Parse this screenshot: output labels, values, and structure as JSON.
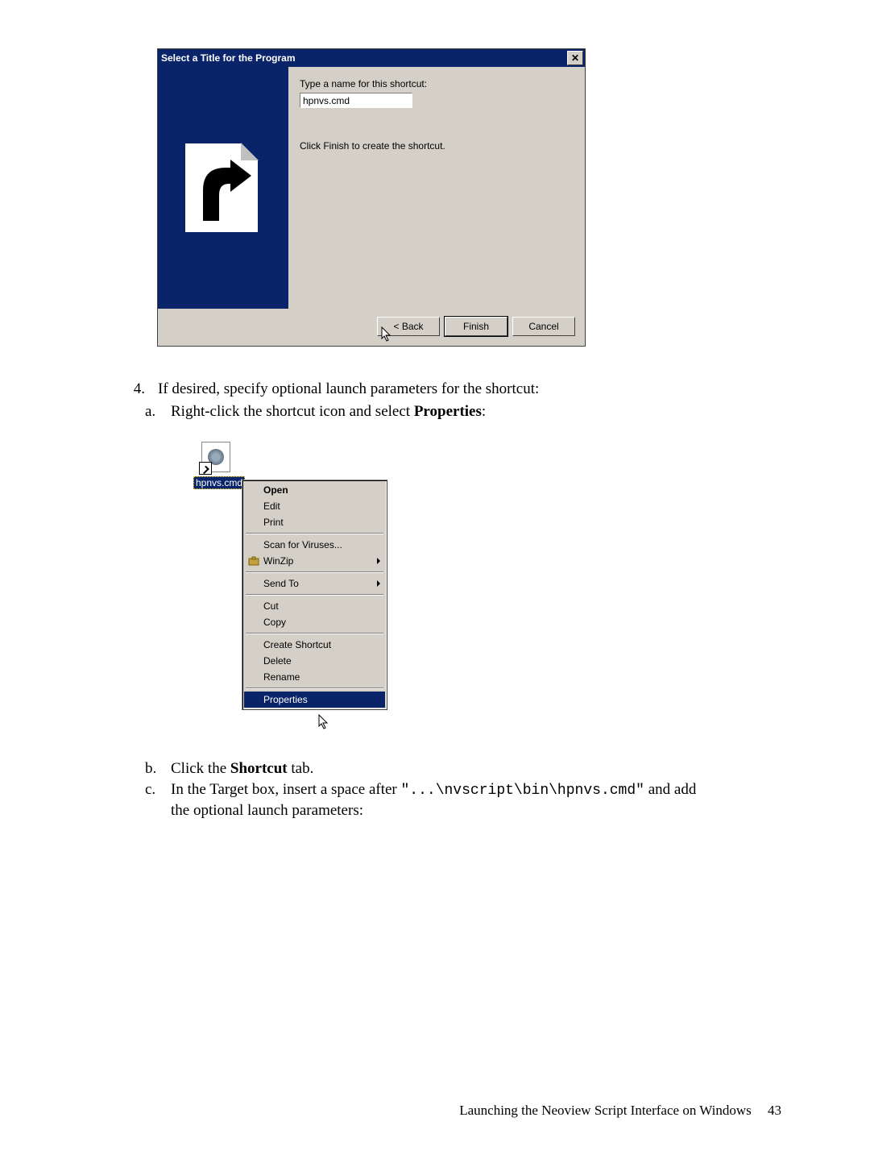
{
  "dialog": {
    "title": "Select a Title for the Program",
    "close_label": "✕",
    "label": "Type a name for this shortcut:",
    "input_value": "hpnvs.cmd",
    "instruction": "Click Finish to create the shortcut.",
    "buttons": {
      "back": "< Back",
      "finish": "Finish",
      "cancel": "Cancel"
    }
  },
  "step4": {
    "number": "4.",
    "text": "If desired, specify optional launch parameters for the shortcut:",
    "a": {
      "letter": "a.",
      "pre": "Right-click the shortcut icon and select ",
      "bold": "Properties",
      "post": ":"
    },
    "b": {
      "letter": "b.",
      "pre": "Click the ",
      "bold": "Shortcut",
      "post": " tab."
    },
    "c": {
      "letter": "c.",
      "pre": "In the Target box, insert a space after ",
      "code": "\"...\\nvscript\\bin\\hpnvs.cmd\"",
      "post1": " and add",
      "post2": "the optional launch parameters:"
    }
  },
  "shortcut": {
    "label": "hpnvs.cmd"
  },
  "context_menu": {
    "open": "Open",
    "edit": "Edit",
    "print": "Print",
    "scan": "Scan for Viruses...",
    "winzip": "WinZip",
    "sendto": "Send To",
    "cut": "Cut",
    "copy": "Copy",
    "create_shortcut": "Create Shortcut",
    "delete": "Delete",
    "rename": "Rename",
    "properties": "Properties"
  },
  "footer": {
    "text": "Launching the Neoview Script Interface on Windows",
    "page": "43"
  }
}
